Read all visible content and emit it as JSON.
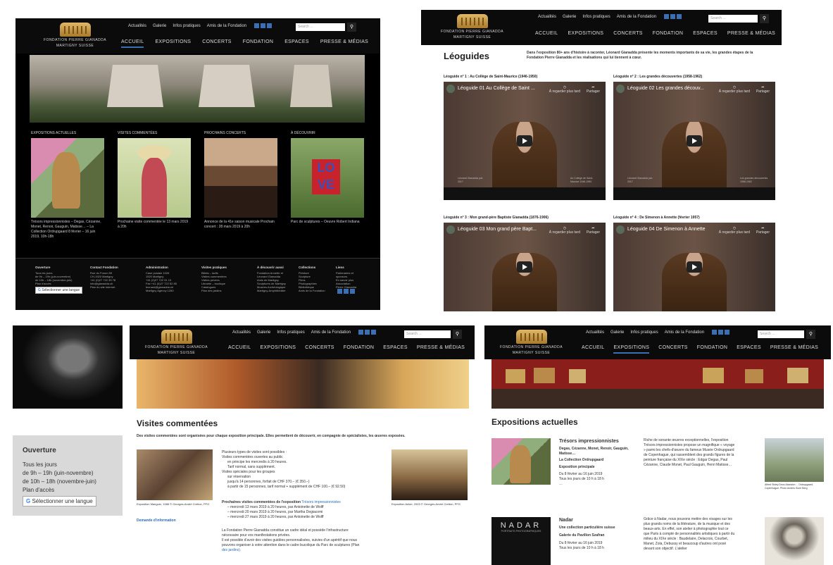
{
  "common": {
    "logo_line1": "FONDATION PIERRE GIANADDA",
    "logo_line2": "MARTIGNY SUISSE",
    "top_links": [
      "Actualités",
      "Galerie",
      "Infos pratiques",
      "Amis de la Fondation"
    ],
    "search_placeholder": "Search ...",
    "main_nav": [
      "ACCUEIL",
      "EXPOSITIONS",
      "CONCERTS",
      "FONDATION",
      "ESPACES",
      "PRESSE & MÉDIAS"
    ]
  },
  "home": {
    "sections": [
      {
        "heading": "EXPOSITIONS ACTUELLES",
        "caption": "Trésors impressionnistes – Degas, Cézanne, Monet, Renoir, Gauguin, Matisse… – La Collection Ordrupgaard 8 février – 16 juin 2019, 10h-18h"
      },
      {
        "heading": "VISITES COMMENTÉES",
        "caption": "Prochaine visite commentée le 13 mars 2019 à 20h"
      },
      {
        "heading": "PROCHAINS CONCERTS",
        "caption": "Annonce de la 41e saison musicale Prochain concert : 28 mars 2019 à 20h"
      },
      {
        "heading": "À DÉCOUVRIR",
        "caption": "Parc de sculptures – Oeuvre Robert Indiana"
      }
    ],
    "footer": [
      {
        "title": "Ouverture",
        "lines": [
          "Tous les jours",
          "de 9h – 19h (juin-novembre)",
          "de 10h – 18h (novembre-juin)",
          "Plan d'accès"
        ]
      },
      {
        "title": "Contact Fondation",
        "lines": [
          "Rue du Forum 59",
          "CH-1920 Martigny",
          "+41 (0)27 722 39 78",
          "info@gianadda.ch",
          "Plan du site internet"
        ]
      },
      {
        "title": "Administration",
        "lines": [
          "Case postale 1026",
          "1920 Martigny",
          "+41 (0)27 722 31 13",
          "Fax +41 (0)27 722 52 85",
          "leonard@gianadda.ch",
          "Martigny Agency 1260"
        ]
      },
      {
        "title": "Visites pratiques",
        "lines": [
          "Billets – tarifs",
          "Visites commentées",
          "Visites privées",
          "Librairie – boutique",
          "Catalogues",
          "Plan des jardins"
        ]
      },
      {
        "title": "À découvrir aussi",
        "lines": [
          "Fondation Annette et",
          "Léonard Gianadda",
          "Amis de Martigny",
          "Sculptures de Martigny",
          "Musées Archéologique",
          "Martigny-Amphithéâtre"
        ]
      },
      {
        "title": "Collections",
        "lines": [
          "Peinture",
          "Sculpture",
          "Films",
          "Photographies",
          "Bibliothèque",
          "Amis de la Fondation"
        ]
      },
      {
        "title": "Liens",
        "lines": [
          "Partenaires et",
          "sponsors",
          "En savoir plus",
          "Association",
          "Pierre Gianadda"
        ]
      }
    ],
    "lang_button": "Sélectionner une langue"
  },
  "leoguides": {
    "title": "Léoguides",
    "intro_link": "80+ ans d'histoire à raconter",
    "intro": "Dans l'exposition 80+ ans d'histoire à raconter, Léonard Gianadda présente les moments importants de sa vie, les grandes étapes de la Fondation Pierre Gianadda et les réalisations qui lui tiennent à cœur.",
    "videos": [
      {
        "label": "Léoguide n° 1 : Au Collège de Saint-Maurice (1946-1950)",
        "title": "Léoguide 01 Au Collège de Saint ...",
        "left": "Léonard Gianadda juin 2017",
        "right": "Au Collège de Saint-Maurice 1946-1950"
      },
      {
        "label": "Léoguide n° 2 : Les grandes découvertes (1958-1962)",
        "title": "Léoguide 02 Les grandes découv...",
        "left": "Léonard Gianadda juin 2017",
        "right": "Les grandes découvertes 1958-1962"
      },
      {
        "label": "Léoguide n° 3 : Mon grand-père Baptiste Gianadda (1876-1906)",
        "title": "Léoguide 03 Mon grand père Bapt...",
        "left": "",
        "right": ""
      },
      {
        "label": "Léoguide n° 4 : De Simenon à Annette (février 1957)",
        "title": "Léoguide 04 De Simenon à Annette",
        "left": "",
        "right": ""
      }
    ],
    "watch_later": "À regarder plus tard",
    "share": "Partager"
  },
  "sidebar": {
    "title": "Ouverture",
    "lines": [
      "Tous les jours",
      "de 9h – 19h (juin-novembre)",
      "de 10h – 18h (novembre-juin)",
      "Plan d'accès"
    ],
    "lang_button": "Sélectionner une langue"
  },
  "visites": {
    "title": "Visites commentées",
    "intro": "Des visites commentées sont organisées pour chaque exposition principale. Elles permettent de découvrir, en compagnie de spécialistes, les œuvres exposées.",
    "left_caption": "Exposition Manguin, 1988 © Georges-André Cretton, PFG",
    "left_link": "Demande d'information",
    "right_caption": "Exposition Anker, 2003 © Georges-André Cretton, PFG",
    "body_lines": [
      "Plusieurs types de visites sont possibles :",
      "Visites commentées ouvertes au public",
      "en principe les mercredis à 20 heures.",
      "Tarif normal, sans supplément.",
      "Visites spéciales pour les groupes",
      "sur réservation",
      "jusqu'à 14 personnes, forfait de CHF 370.– (€ 350.–)",
      "à partir de 15 personnes, tarif normal + supplément de CHF 100.– (€ 92.50)"
    ],
    "next_title": "Prochaines visites commentées de l'exposition",
    "next_link": "Trésors impressionnistes",
    "next_lines": [
      "– mercredi 13 mars 2019 à 20 heures, par Antoinette de Wolff",
      "– mercredi 20 mars 2019 à 20 heures, par Martha Degiacomi",
      "– mercredi 27 mars 2019 à 20 heures, par Antoinette de Wolff"
    ],
    "outro_lines": [
      "La Fondation Pierre Gianadda constitue un cadre idéal et possède l'infrastructure",
      "nécessaire pour vos manifestations privées.",
      "Il est possible d'avoir des visites guidées personnalisées, suivies d'un apéritif que nous",
      "pouvons organiser à votre attention dans le cadre bucolique du Parc de sculptures (Plan",
      "des jardins)."
    ]
  },
  "expositions": {
    "title": "Expositions actuelles",
    "items": [
      {
        "name": "Trésors impressionnistes",
        "artists": "Degas, Cézanne, Monet, Renoir, Gauguin, Matisse…",
        "collection": "La Collection Ordrupgaard",
        "kind": "Exposition principale",
        "dates": "Du 8 février au 16 juin 2019",
        "hours": "Tous les jours de 10 h à 18 h",
        "more": "…",
        "desc": "Riche de sonante œuvres exceptionnelles, l'exposition Trésors impressionnistes propose un magnifique « voyage » parmi les chefs-d'œuvre du fameux Musée Ordrupgaard de Copenhague, qui rassemblent des grands figures de la peinture française du XIXe siècle : Edgar Degas, Paul Cézanne, Claude Monet, Paul Gauguin, Henri Matisse…",
        "art_caption": "Alfred Sisley Deux Abandon ... Ordrupgaard, Copenhague. Photo Anders Sune Berg"
      },
      {
        "name": "Nadar",
        "artists": "Une collection particulière suisse",
        "collection": "Galerie du Pavillon Szafran",
        "kind": "",
        "dates": "Du 8 février au 16 juin 2019",
        "hours": "Tous les jours de 10 h à 18 h",
        "more": "",
        "desc": "Grâce à Nadar, nous pouvons mettre des visages sur les plus grands noms de la littérature, de la musique et des beaux-arts. En effet, son atelier à photographie tout ce que Paris à compté de personnalités artistiques à partir du milieu du XIXe siècle : Baudelaire, Delacroix, Courbet, Manet, Zola, Debussy et beaucoup d'autres ont posé devant son objectif. L'atelier",
        "poster_title": "NADAR",
        "poster_sub": "PORTRAITS PHOTOGRAPHIQUES"
      }
    ]
  }
}
